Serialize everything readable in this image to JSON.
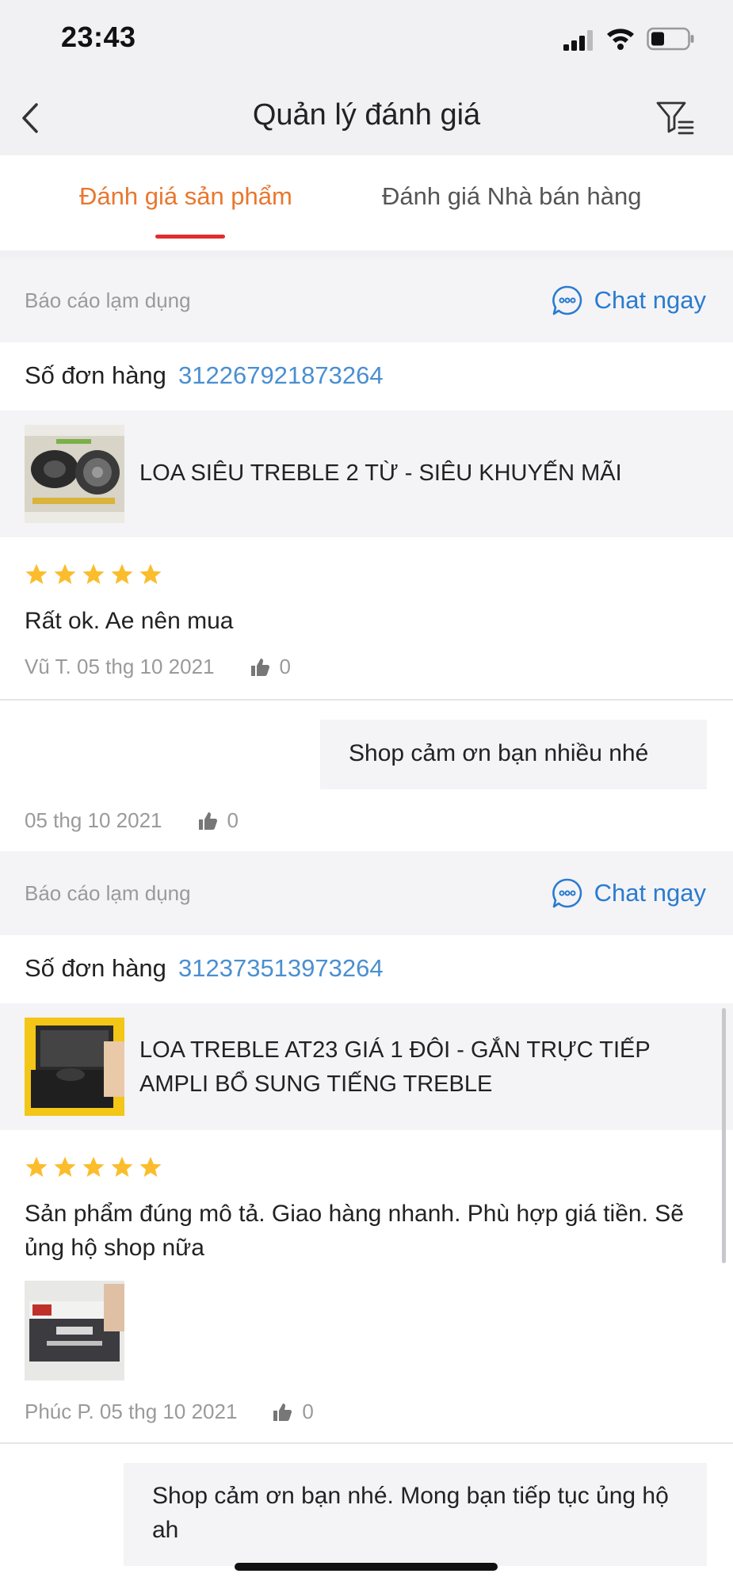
{
  "status_bar": {
    "time": "23:43"
  },
  "nav": {
    "title": "Quản lý đánh giá",
    "back_icon": "chevron-left-icon",
    "filter_icon": "filter-list-icon"
  },
  "tabs": [
    {
      "label": "Đánh giá sản phẩm",
      "active": true
    },
    {
      "label": "Đánh giá Nhà bán hàng",
      "active": false
    }
  ],
  "colors": {
    "accent": "#e8772e",
    "underline": "#e02d2d",
    "link": "#2a7bd0",
    "order_num": "#4a8fd0",
    "star": "#fbbd2c"
  },
  "reviews": [
    {
      "report_label": "Báo cáo lạm dụng",
      "chat_label": "Chat ngay",
      "order_label": "Số đơn hàng",
      "order_number": "312267921873264",
      "product_name": "LOA SIÊU TREBLE 2 TỪ - SIÊU KHUYẾN MÃI",
      "rating": 5,
      "text": "Rất ok. Ae nên mua",
      "author_date": "Vũ T. 05 thg 10 2021",
      "likes": "0",
      "reply": {
        "text": "Shop cảm ơn bạn nhiều nhé",
        "date": "05 thg 10 2021",
        "likes": "0"
      }
    },
    {
      "report_label": "Báo cáo lạm dụng",
      "chat_label": "Chat ngay",
      "order_label": "Số đơn hàng",
      "order_number": "312373513973264",
      "product_name": "LOA TREBLE AT23 GIÁ 1 ĐÔI - GẮN TRỰC TIẾP AMPLI BỔ SUNG TIẾNG TREBLE",
      "rating": 5,
      "text": "Sản phẩm đúng mô tả. Giao hàng nhanh. Phù hợp giá tiền. Sẽ ủng hộ shop nữa",
      "author_date": "Phúc P. 05 thg 10 2021",
      "likes": "0",
      "reply": {
        "text": "Shop cảm ơn bạn nhé. Mong bạn tiếp tục ủng hộ ah"
      }
    }
  ]
}
